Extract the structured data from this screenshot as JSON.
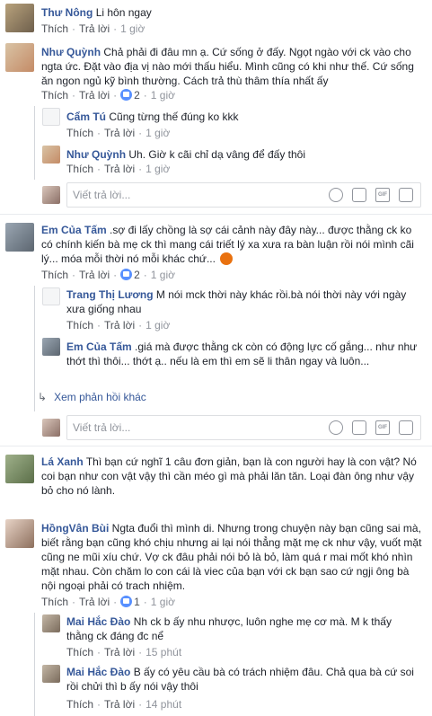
{
  "labels": {
    "like": "Thích",
    "reply": "Trả lời",
    "sep": "·",
    "reply_placeholder": "Viết trả lời...",
    "view_more_replies": "Xem phản hồi khác",
    "gif": "GIF"
  },
  "comments": [
    {
      "name": "Thư Nông",
      "text": "Li hôn ngay",
      "time": "1 giờ"
    },
    {
      "name": "Như Quỳnh",
      "text": "Chả phải đi đâu mn ạ. Cứ sống ở đấy. Ngọt ngào với ck vào cho ngta ức. Đặt vào địa vị nào mới thấu hiểu. Mình cũng có khi như thế. Cứ sống ăn ngon ngủ kỹ bình thường. Cách trả thù thâm thía nhất ấy",
      "reactions": "2",
      "time": "1 giờ",
      "replies": [
        {
          "name": "Cẩm Tú",
          "text": "Cũng từng thế đúng ko kkk",
          "time": "1 giờ"
        },
        {
          "name": "Như Quỳnh",
          "text": "Uh. Giờ k cãi chỉ dạ vâng để đấy thôi",
          "time": "1 giờ"
        }
      ]
    },
    {
      "name": "Em Của Tấm",
      "text": ".sợ đi lấy chồng là sợ cái cảnh này đây này... được thằng ck ko có chính kiến bà mẹ ck thì mang cái triết lý xa xưa ra bàn luận rồi nói mình cãi lý... móa mỗi thời nó mỗi khác chứ...",
      "reactions": "2",
      "time": "1 giờ",
      "replies": [
        {
          "name": "Trang Thị Lương",
          "text": "M nói mck thời này khác rồi.bà nói thời này với ngày xưa giống nhau",
          "time": "1 giờ"
        },
        {
          "name": "Em Của Tấm",
          "text": ".giá mà được thằng ck còn có động lực cố gắng... như như thớt thì thôi... thớt ạ.. nếu là em thì em sẽ li thân ngay và luôn...",
          "time": "1 giờ"
        }
      ]
    },
    {
      "name": "Lá Xanh",
      "text": "Thì bạn cứ nghĩ 1 câu đơn giản, bạn là con người hay là con vật? Nó coi bạn như con vật vậy thì cần méo gì mà phải lăn tăn. Loại đàn ông như vậy bỏ cho nó lành.",
      "time": "1 giờ"
    },
    {
      "name": "HồngVân Bùi",
      "text": "Ngta đuổi thì mình di. Nhưng trong chuyện này bạn cũng sai mà, biết rằng bạn cũng khó chịu nhưng ai lại nói thẳng mặt mẹ ck như vậy, vuốt mặt cũng ne mũi xíu chứ. Vợ ck đâu phải nói bỏ là bỏ, làm quá r mai mốt khó nhìn mặt nhau. Còn chăm lo con cái là viec của bạn với ck bạn sao cứ ngji ông bà nội ngoại phải có trach nhiệm.",
      "reactions": "1",
      "time": "1 giờ",
      "replies": [
        {
          "name": "Mai Hắc Đào",
          "text": "Nh ck b ấy nhu nhược, luôn nghe mẹ cơ mà. M k thấy thằng ck đáng đc nể",
          "time": "15 phút"
        },
        {
          "name": "Mai Hắc Đào",
          "text": "B ấy có yêu cầu bà có trách nhiệm đâu. Chả qua bà cứ soi rồi chửi thì b ấy nói vậy thôi",
          "time": "14 phút"
        }
      ]
    }
  ]
}
